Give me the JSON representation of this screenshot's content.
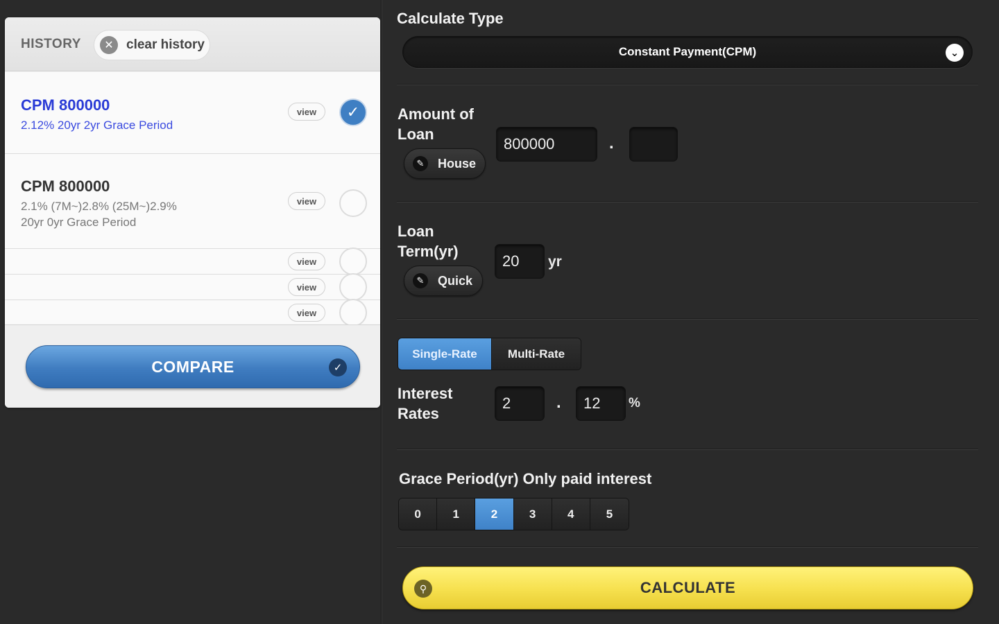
{
  "history": {
    "title": "HISTORY",
    "clear_label": "clear history",
    "items": [
      {
        "title": "CPM 800000",
        "subtitle": "2.12% 20yr 2yr Grace Period",
        "view_label": "view",
        "checked": true
      },
      {
        "title": "CPM 800000",
        "subtitle_line1": "2.1% (7M~)2.8% (25M~)2.9%",
        "subtitle_line2": "20yr 0yr Grace Period",
        "view_label": "view",
        "checked": false
      },
      {
        "title": "",
        "view_label": "view",
        "checked": false
      },
      {
        "title": "",
        "view_label": "view",
        "checked": false
      },
      {
        "title": "",
        "view_label": "view",
        "checked": false
      }
    ],
    "compare_label": "COMPARE"
  },
  "form": {
    "calc_type_label": "Calculate Type",
    "calc_type_value": "Constant Payment(CPM)",
    "amount_label_line1": "Amount of",
    "amount_label_line2": "Loan",
    "amount_preset_label": "House",
    "amount_value": "800000",
    "amount_decimal_separator": ".",
    "amount_decimal_value": "",
    "term_label_line1": "Loan",
    "term_label_line2": "Term(yr)",
    "term_preset_label": "Quick",
    "term_value": "20",
    "term_unit": "yr",
    "rate_tabs": [
      {
        "label": "Single-Rate",
        "active": true
      },
      {
        "label": "Multi-Rate",
        "active": false
      }
    ],
    "rate_label_line1": "Interest",
    "rate_label_line2": "Rates",
    "rate_int": "2",
    "rate_separator": ".",
    "rate_frac": "12",
    "rate_unit": "%",
    "grace_label": "Grace Period(yr) Only paid interest",
    "grace_options": [
      "0",
      "1",
      "2",
      "3",
      "4",
      "5"
    ],
    "grace_selected": "2",
    "calculate_label": "CALCULATE"
  },
  "colors": {
    "accent_blue": "#3f82c8",
    "calculate_yellow": "#f6e04e",
    "selected_history_text": "#2b3cd6",
    "background": "#2a2a2a"
  },
  "icons": {
    "clear": "close-circle-icon",
    "checked": "checkmark-icon",
    "dropdown": "chevron-down-icon",
    "edit": "pencil-icon",
    "calculate": "search-icon"
  }
}
